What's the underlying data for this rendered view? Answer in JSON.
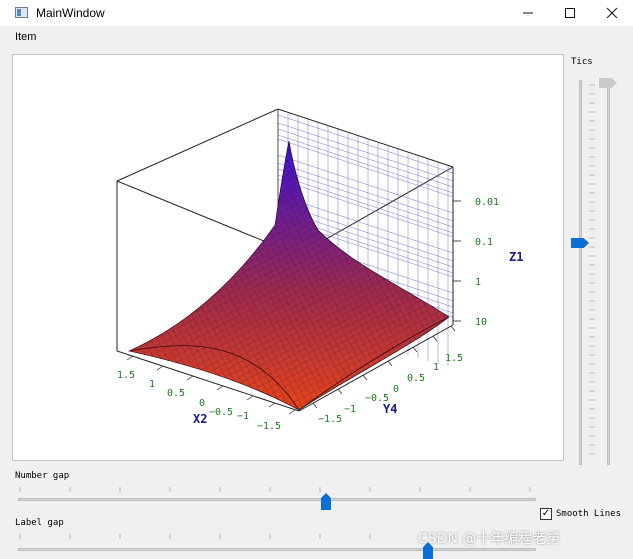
{
  "window": {
    "title": "MainWindow"
  },
  "menu": {
    "items": [
      "Item"
    ]
  },
  "plot": {
    "x_axis_label": "X2",
    "y_axis_label": "Y4",
    "z_axis_label": "Z1",
    "x_ticks": [
      "1.5",
      "1",
      "0.5",
      "0",
      "−0.5",
      "−1",
      "−1.5"
    ],
    "y_ticks": [
      "−1.5",
      "−1",
      "−0.5",
      "0",
      "0.5",
      "1",
      "1.5"
    ],
    "z_ticks": [
      "0.01",
      "0.1",
      "1",
      "10"
    ],
    "colors": {
      "surface_low": "#e8451a",
      "surface_mid": "#9b2a4e",
      "surface_high": "#3b10d8",
      "grid": "#5a5ad0",
      "tick_text": "#1a7a1a",
      "axis_label": "#1a1a8a"
    }
  },
  "controls": {
    "tics_label": "Tics",
    "number_gap_label": "Number gap",
    "label_gap_label": "Label gap",
    "smooth_lines_label": "Smooth Lines",
    "smooth_lines_checked": "✓",
    "number_gap_value": 0.58,
    "label_gap_value": 0.78,
    "tics_value": 0.42
  },
  "watermark": "CSDN @十年编程老舅"
}
